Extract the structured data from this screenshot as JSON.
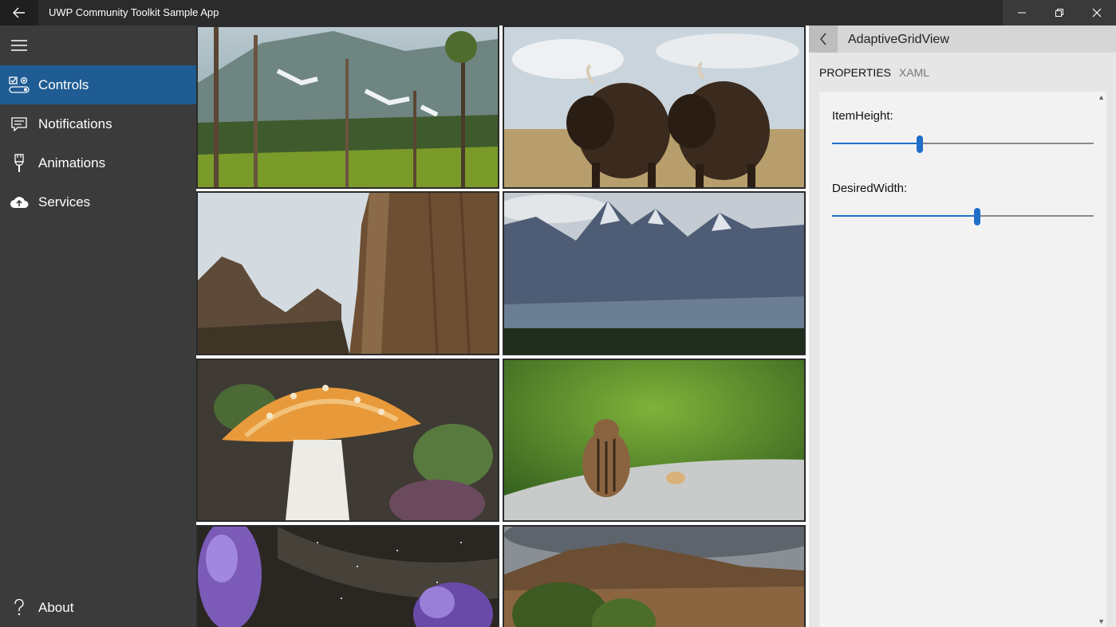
{
  "window": {
    "title": "UWP Community Toolkit Sample App"
  },
  "sidebar": {
    "items": [
      {
        "label": "Controls",
        "icon": "controls-icon",
        "active": true
      },
      {
        "label": "Notifications",
        "icon": "notifications-icon",
        "active": false
      },
      {
        "label": "Animations",
        "icon": "animations-icon",
        "active": false
      },
      {
        "label": "Services",
        "icon": "services-icon",
        "active": false
      }
    ],
    "footer": {
      "label": "About",
      "icon": "help-icon"
    }
  },
  "gallery": {
    "tiles": [
      "forest-mountain-photo",
      "bison-photo",
      "canyon-cliff-photo",
      "mountain-range-photo",
      "mushroom-photo",
      "chipmunk-photo",
      "milky-way-flowers-photo",
      "mesa-trees-photo"
    ]
  },
  "panel": {
    "title": "AdaptiveGridView",
    "tabs": [
      {
        "label": "PROPERTIES",
        "active": true
      },
      {
        "label": "XAML",
        "active": false
      }
    ],
    "properties": [
      {
        "label": "ItemHeight:",
        "value_fraction": 0.335
      },
      {
        "label": "DesiredWidth:",
        "value_fraction": 0.555
      }
    ]
  },
  "colors": {
    "accent": "#1f5c93",
    "slider": "#1f6fc9",
    "sidebar": "#3b3b3b"
  }
}
